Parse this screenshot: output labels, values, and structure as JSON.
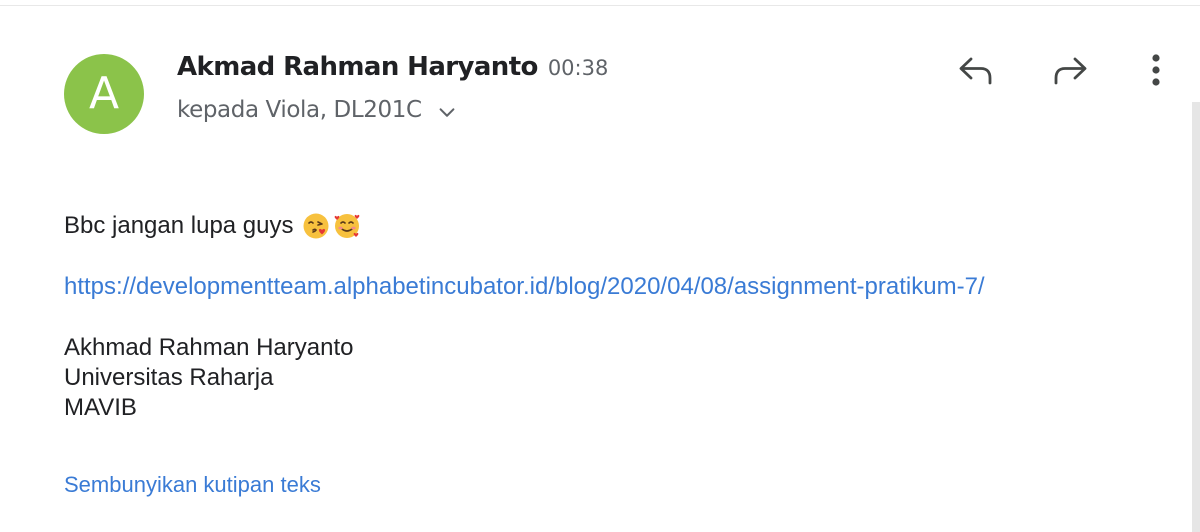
{
  "header": {
    "avatar_letter": "A",
    "avatar_color": "#8bc34a",
    "sender_name": "Akmad Rahman Haryanto",
    "time": "00:38",
    "recipients": "kepada Viola, DL201C"
  },
  "actions": {
    "reply_icon": "reply-icon",
    "forward_icon": "forward-icon",
    "more_icon": "more-vertical-icon"
  },
  "message": {
    "greeting": "Bbc jangan lupa guys",
    "emojis": [
      "face-blowing-kiss-emoji",
      "smiling-face-with-hearts-emoji"
    ],
    "link": "https://developmentteam.alphabetincubator.id/blog/2020/04/08/assignment-pratikum-7/",
    "signature": {
      "name": "Akhmad Rahman Haryanto",
      "organization": "Universitas Raharja",
      "unit": "MAVIB"
    },
    "hide_quoted_label": "Sembunyikan kutipan teks"
  },
  "colors": {
    "link": "#3a7bd5",
    "text": "#202124",
    "muted": "#5f6368"
  }
}
